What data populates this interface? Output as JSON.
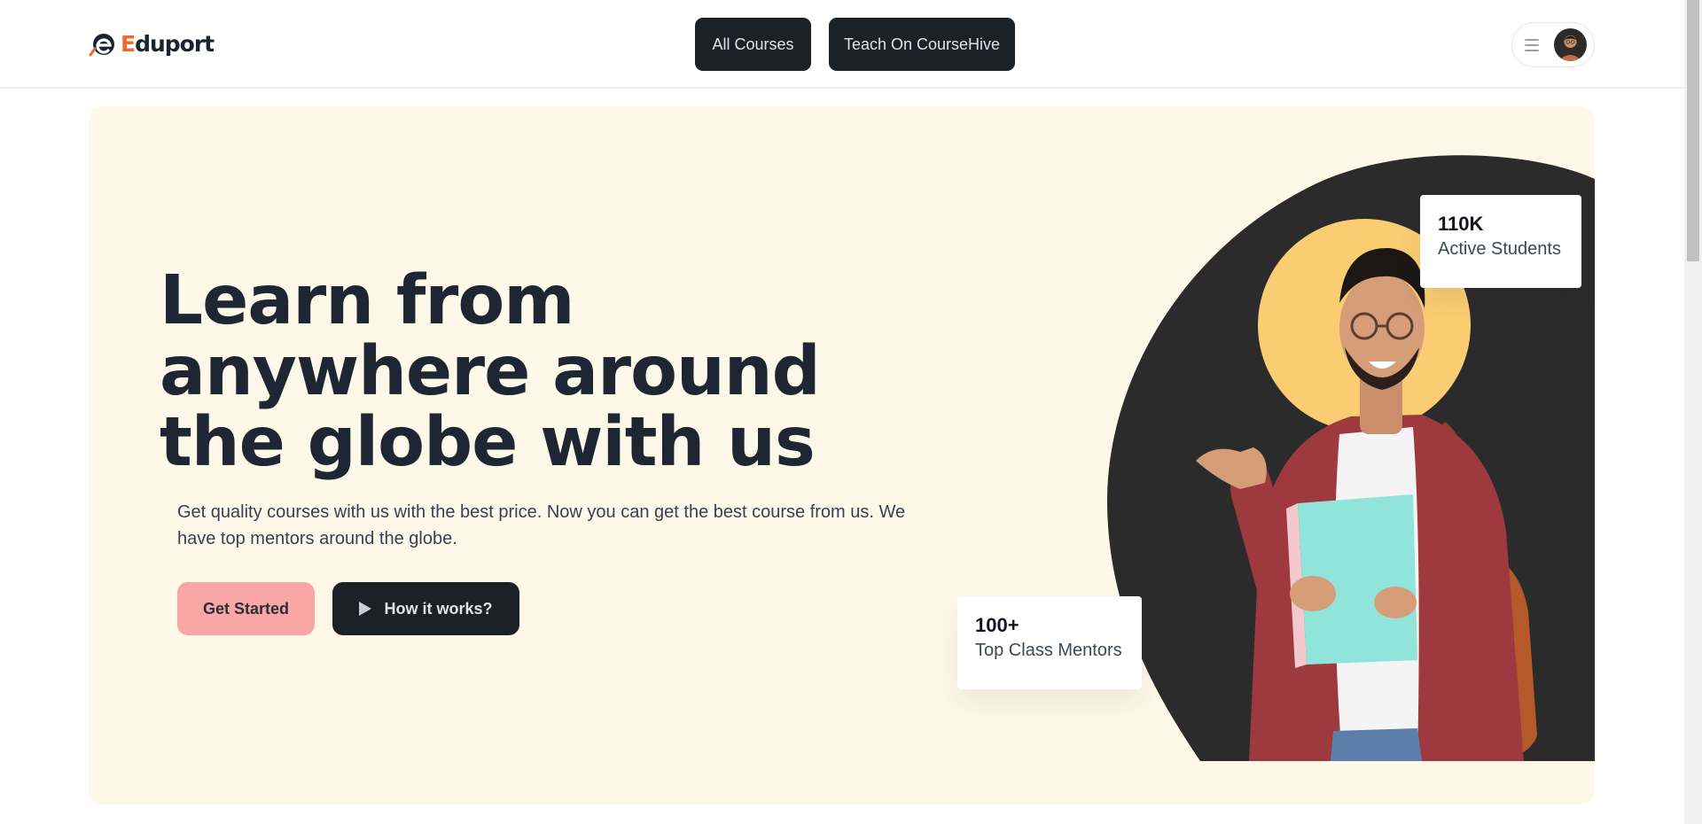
{
  "brand": {
    "first_letter": "E",
    "rest": "duport",
    "accent_color": "#ef6a2e"
  },
  "nav": {
    "all_courses": "All Courses",
    "teach": "Teach On CourseHive"
  },
  "user_menu": {
    "menu_icon": "hamburger-icon",
    "avatar_icon": "user-avatar"
  },
  "hero": {
    "title": "Learn from anywhere around the globe with us",
    "subtitle": "Get quality courses with us with the best price. Now you can get the best course from us. We have top mentors around the globe.",
    "get_started": "Get Started",
    "how_it_works": "How it works?",
    "play_icon": "play-icon",
    "background_color": "#fdf8e7"
  },
  "stats": {
    "students": {
      "value": "110K",
      "label": "Active Students"
    },
    "mentors": {
      "value": "100+",
      "label": "Top Class Mentors"
    }
  },
  "colors": {
    "dark_button": "#1c2027",
    "primary_button": "#f9a7a6",
    "art_dark": "#2b2b2b",
    "art_circle": "#fbcd72"
  }
}
